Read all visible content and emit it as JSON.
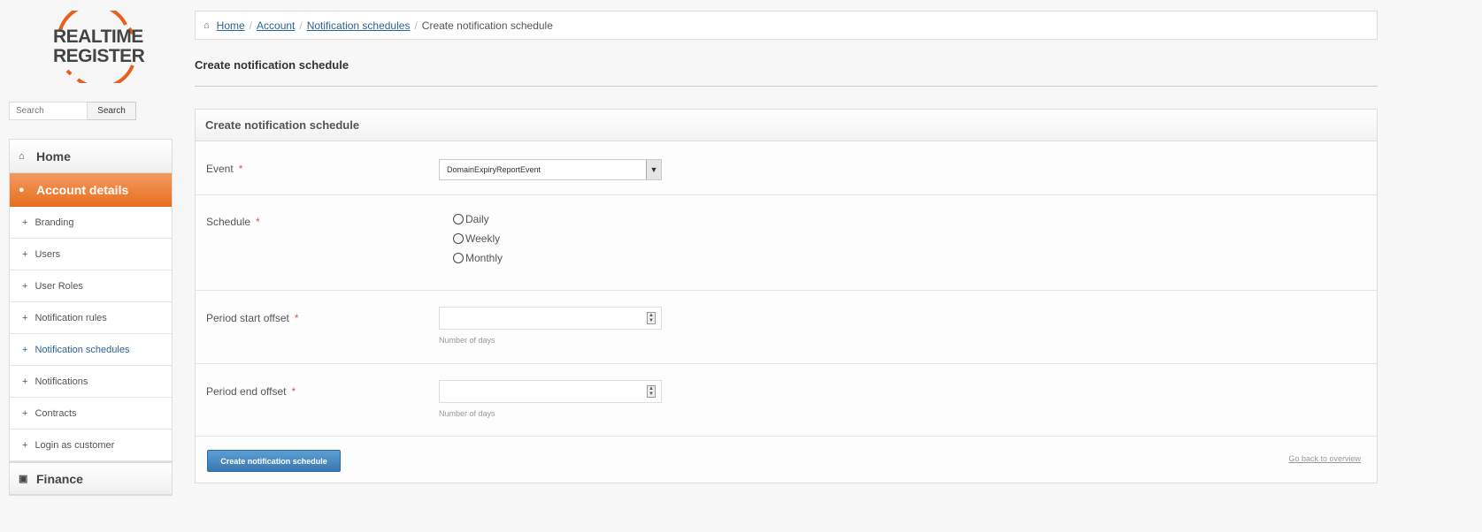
{
  "logo": {
    "line1": "REALTIME",
    "line2": "REGISTER",
    "brand_color": "#e8601c"
  },
  "search": {
    "placeholder": "Search",
    "button": "Search"
  },
  "nav": {
    "home": "Home",
    "account": "Account details",
    "items": [
      "Branding",
      "Users",
      "User Roles",
      "Notification rules",
      "Notification schedules",
      "Notifications",
      "Contracts",
      "Login as customer"
    ],
    "finance": "Finance"
  },
  "breadcrumb": {
    "home": "Home",
    "account": "Account",
    "schedules": "Notification schedules",
    "current": "Create notification schedule"
  },
  "page_title": "Create notification schedule",
  "form": {
    "title": "Create notification schedule",
    "event_label": "Event",
    "event_value": "DomainExpiryReportEvent",
    "schedule_label": "Schedule",
    "schedule_options": [
      "Daily",
      "Weekly",
      "Monthly"
    ],
    "start_label": "Period start offset",
    "start_value": "",
    "start_hint": "Number of days",
    "end_label": "Period end offset",
    "end_value": "",
    "end_hint": "Number of days",
    "required": "*",
    "submit": "Create notification schedule",
    "back": "Go back to overview"
  }
}
